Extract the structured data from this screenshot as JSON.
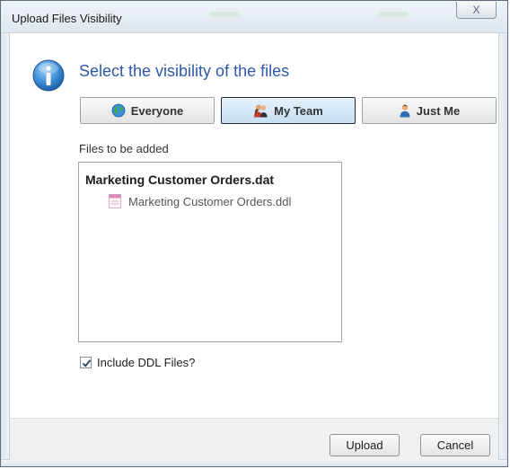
{
  "window": {
    "title": "Upload Files Visibility",
    "close_glyph": "X"
  },
  "dialog": {
    "heading": "Select the visibility of the files",
    "info_icon": "info-icon"
  },
  "visibility_options": [
    {
      "label": "Everyone",
      "icon": "globe-icon",
      "selected": false
    },
    {
      "label": "My Team",
      "icon": "team-icon",
      "selected": true
    },
    {
      "label": "Just Me",
      "icon": "user-icon",
      "selected": false
    }
  ],
  "files": {
    "label": "Files to be added",
    "items": [
      {
        "name": "Marketing Customer Orders.dat",
        "bold": true
      },
      {
        "name": "Marketing Customer Orders.ddl",
        "icon": "ddl-file-icon"
      }
    ]
  },
  "include_ddl": {
    "label": "Include DDL Files?",
    "checked": true
  },
  "footer": {
    "upload_label": "Upload",
    "cancel_label": "Cancel"
  },
  "colors": {
    "heading": "#2f58a8",
    "selected_button_bg": "#c6dff3",
    "footer_bg": "#f0f0f0"
  }
}
